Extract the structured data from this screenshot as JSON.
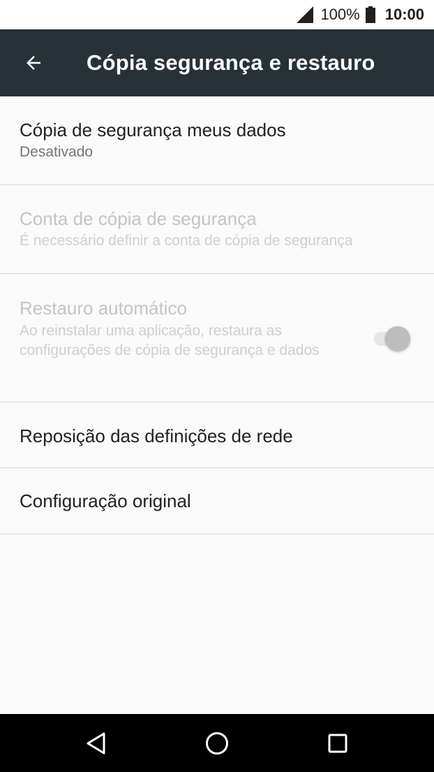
{
  "status_bar": {
    "battery_percent": "100%",
    "time": "10:00"
  },
  "app_bar": {
    "title": "Cópia segurança e restauro"
  },
  "settings": {
    "items": [
      {
        "title": "Cópia de segurança meus dados",
        "summary": "Desativado",
        "enabled": true
      },
      {
        "title": "Conta de cópia de segurança",
        "summary": "É necessário definir a conta de cópia de segurança",
        "enabled": false
      },
      {
        "title": "Restauro automático",
        "summary": "Ao reinstalar uma aplicação, restaura as configurações de cópia de segurança e dados",
        "enabled": false,
        "toggle_on": false
      },
      {
        "title": "Reposição das definições de rede",
        "enabled": true
      },
      {
        "title": "Configuração original",
        "enabled": true
      }
    ]
  },
  "colors": {
    "app_bar": "#263238",
    "background": "#fafafa",
    "nav_bar": "#000000"
  },
  "icons": {
    "back": "arrow-left-icon",
    "signal": "cell-signal-icon",
    "battery": "battery-icon",
    "nav_back": "triangle-back-icon",
    "nav_home": "circle-home-icon",
    "nav_recent": "square-recents-icon"
  }
}
